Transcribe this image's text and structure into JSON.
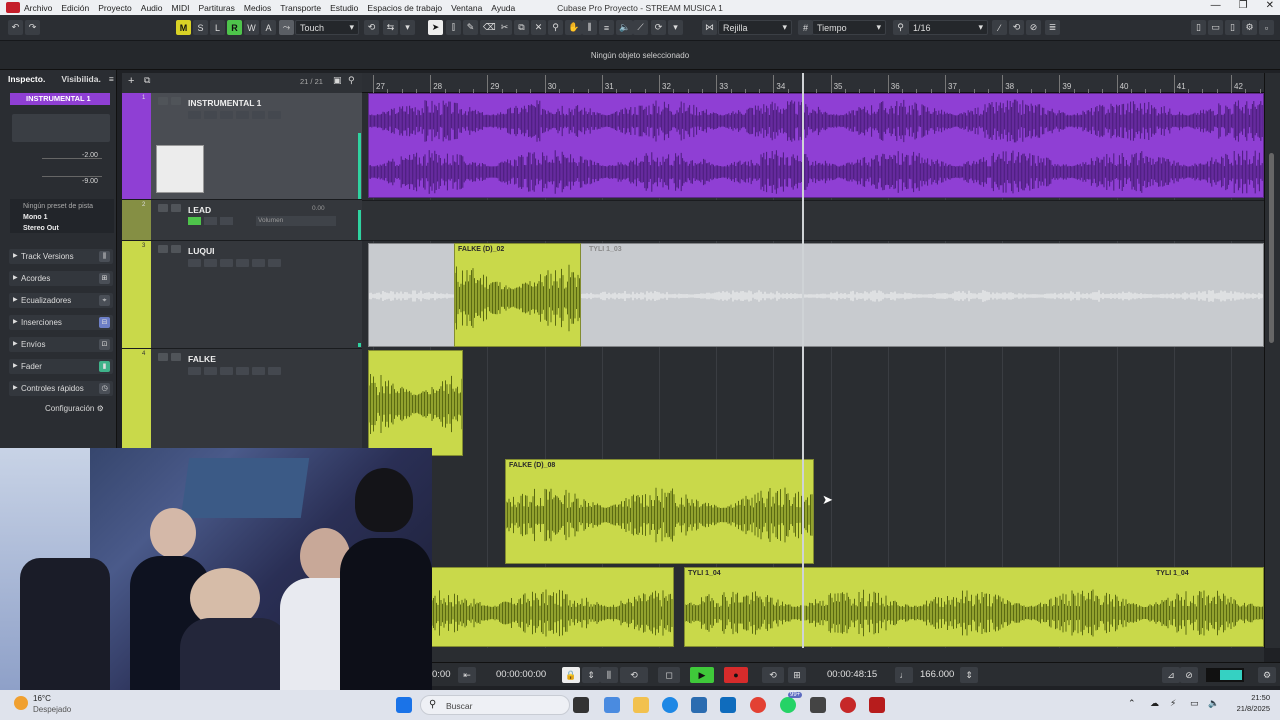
{
  "menu": {
    "items": [
      "Archivo",
      "Edición",
      "Proyecto",
      "Audio",
      "MIDI",
      "Partituras",
      "Medios",
      "Transporte",
      "Estudio",
      "Espacios de trabajo",
      "Ventana",
      "Ayuda"
    ],
    "window_title": "Cubase Pro Proyecto - STREAM MUSICA 1"
  },
  "toolbar": {
    "m": "M",
    "s": "S",
    "l": "L",
    "r": "R",
    "w": "W",
    "a": "A",
    "automation_mode": "Touch",
    "snap_type": "Rejilla",
    "grid_type": "Tiempo",
    "quantize": "1/16"
  },
  "info_line": "Ningún objeto seleccionado",
  "inspector": {
    "tab_inspector": "Inspecto.",
    "tab_visibility": "Visibilida.",
    "track_name": "INSTRUMENTAL 1",
    "volume": "-2.00",
    "pan": "-9.00",
    "preset": "Ningún preset de pista",
    "input": "Mono 1",
    "output": "Stereo Out",
    "sections": [
      "Track Versions",
      "Acordes",
      "Ecualizadores",
      "Inserciones",
      "Envíos",
      "Fader",
      "Controles rápidos"
    ],
    "config": "Configuración"
  },
  "tracklist": {
    "count": "21 / 21",
    "tracks": [
      {
        "number": "1",
        "name": "INSTRUMENTAL 1",
        "color": "#8f3fd4"
      },
      {
        "number": "2",
        "name": "LEAD",
        "volume_label": "Volumen",
        "volume_value": "0.00",
        "color": "#c9d94a"
      },
      {
        "number": "3",
        "name": "LUQUI",
        "color": "#c9d94a"
      },
      {
        "number": "4",
        "name": "FALKE",
        "color": "#c9d94a"
      }
    ]
  },
  "ruler": {
    "bars": [
      "27",
      "28",
      "29",
      "30",
      "31",
      "32",
      "33",
      "34",
      "35",
      "36",
      "37",
      "38",
      "39",
      "40",
      "41",
      "42"
    ]
  },
  "events": {
    "luqui_main": "FALKE (D)_02",
    "luqui_ghost": "TYLI 1_03",
    "falke_d08": "FALKE (D)_08",
    "tyli_a": "TYLI 1_04",
    "tyli_b": "TYLI 1_04"
  },
  "transport": {
    "left_time": "0:00",
    "position": "00:00:00:00",
    "time_right": "00:00:48:15",
    "tempo": "166.000"
  },
  "taskbar": {
    "weather_temp": "16°C",
    "weather_desc": "Despejado",
    "search": "Buscar",
    "badge": "99+",
    "clock_time": "21:50",
    "clock_date": "21/8/2025"
  },
  "colors": {
    "purple": "#8f3fd4",
    "lime": "#c9d94a",
    "record": "#d62b2b",
    "play": "#3fc93a"
  }
}
